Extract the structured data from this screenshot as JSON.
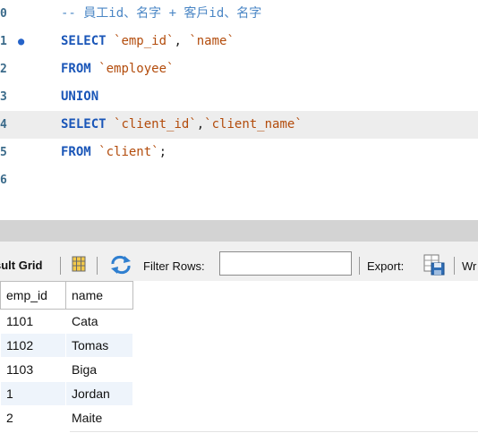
{
  "editor": {
    "lines": [
      {
        "no": "0",
        "tokens": [
          {
            "t": "cmt",
            "v": "-- 員工id、名字 + 客戶id、名字"
          }
        ]
      },
      {
        "no": "1",
        "marker": "●",
        "tokens": [
          {
            "t": "kw",
            "v": "SELECT"
          },
          {
            "t": "plain",
            "v": " "
          },
          {
            "t": "str",
            "v": "`emp_id`"
          },
          {
            "t": "plain",
            "v": ", "
          },
          {
            "t": "str",
            "v": "`name`"
          }
        ]
      },
      {
        "no": "2",
        "tokens": [
          {
            "t": "kw",
            "v": "FROM"
          },
          {
            "t": "plain",
            "v": " "
          },
          {
            "t": "str",
            "v": "`employee`"
          }
        ]
      },
      {
        "no": "3",
        "tokens": [
          {
            "t": "kw",
            "v": "UNION"
          }
        ]
      },
      {
        "no": "4",
        "current": true,
        "tokens": [
          {
            "t": "kw",
            "v": "SELECT"
          },
          {
            "t": "plain",
            "v": " "
          },
          {
            "t": "str",
            "v": "`client_id`"
          },
          {
            "t": "plain",
            "v": ","
          },
          {
            "t": "str",
            "v": "`client_name`"
          }
        ]
      },
      {
        "no": "5",
        "tokens": [
          {
            "t": "kw",
            "v": "FROM"
          },
          {
            "t": "plain",
            "v": " "
          },
          {
            "t": "str",
            "v": "`client`"
          },
          {
            "t": "plain",
            "v": ";"
          }
        ]
      },
      {
        "no": "6",
        "tokens": []
      }
    ]
  },
  "toolbar": {
    "result_grid_label": "sult Grid",
    "filter_label": "Filter Rows:",
    "filter_value": "",
    "export_label": "Export:",
    "wrap_label": "Wr",
    "icons": {
      "grid": "grid-layout-icon",
      "refresh": "refresh-icon",
      "export": "export-icon"
    }
  },
  "result": {
    "columns": [
      "emp_id",
      "name"
    ],
    "rows": [
      [
        "1101",
        "Cata"
      ],
      [
        "1102",
        "Tomas"
      ],
      [
        "1103",
        "Biga"
      ],
      [
        "1",
        "Jordan"
      ],
      [
        "2",
        "Maite"
      ]
    ]
  },
  "colors": {
    "keyword": "#1a56b8",
    "string": "#b34c0c",
    "comment": "#4a86c5",
    "row_alt": "#eef4fb",
    "splitter": "#d3d3d3"
  }
}
